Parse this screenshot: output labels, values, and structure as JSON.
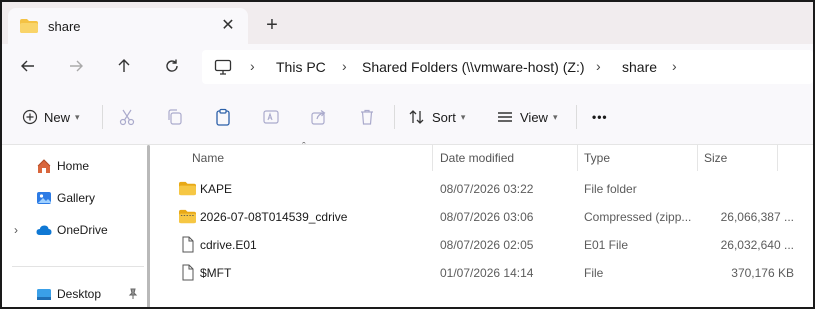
{
  "tab": {
    "title": "share",
    "close_glyph": "✕",
    "new_tab_glyph": "+"
  },
  "address": {
    "crumbs": [
      "This PC",
      "Shared Folders (\\\\vmware-host) (Z:)",
      "share"
    ],
    "separator": "›"
  },
  "toolbar": {
    "new_label": "New",
    "sort_label": "Sort",
    "view_label": "View",
    "more_glyph": "•••"
  },
  "sidebar": {
    "items": [
      {
        "label": "Home",
        "icon": "home-icon"
      },
      {
        "label": "Gallery",
        "icon": "gallery-icon"
      },
      {
        "label": "OneDrive",
        "icon": "cloud-icon"
      },
      {
        "label": "Desktop",
        "icon": "desktop-icon"
      }
    ]
  },
  "columns": {
    "name": "Name",
    "date": "Date modified",
    "type": "Type",
    "size": "Size"
  },
  "files": [
    {
      "name": "KAPE",
      "date": "08/07/2026 03:22",
      "type": "File folder",
      "size": "",
      "icon": "folder-icon"
    },
    {
      "name": "2026-07-08T014539_cdrive",
      "date": "08/07/2026 03:06",
      "type": "Compressed (zipp...",
      "size": "26,066,387 ...",
      "icon": "zip-folder-icon"
    },
    {
      "name": "cdrive.E01",
      "date": "08/07/2026 02:05",
      "type": "E01 File",
      "size": "26,032,640 ...",
      "icon": "file-icon"
    },
    {
      "name": "$MFT",
      "date": "01/07/2026 14:14",
      "type": "File",
      "size": "370,176 KB",
      "icon": "file-icon"
    }
  ],
  "colors": {
    "folder": "#f4c244",
    "accent": "#0067c0",
    "titlebar": "#f1ecee"
  }
}
